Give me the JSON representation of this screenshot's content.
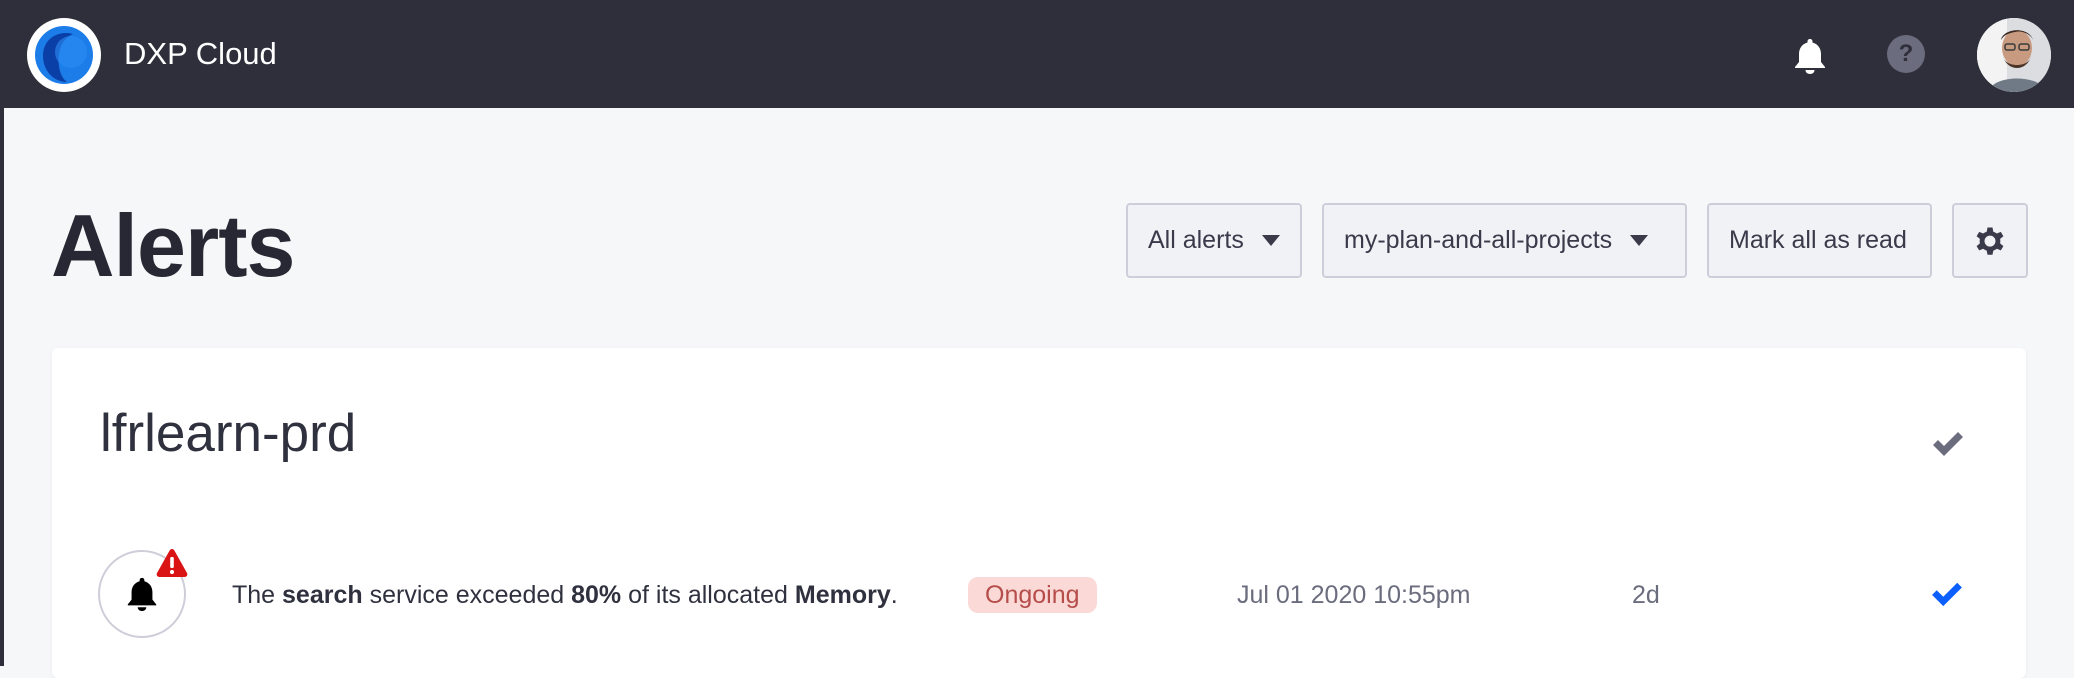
{
  "app": {
    "title": "DXP Cloud",
    "logo_icon": "dxp-cloud-logo",
    "accent": "#0b5fff",
    "navbar_bg": "#2e2f3a"
  },
  "navbar": {
    "bell_icon": "bell-icon",
    "help_label": "?",
    "avatar_icon": "user-avatar"
  },
  "page": {
    "title": "Alerts"
  },
  "toolbar": {
    "filter_label": "All alerts",
    "project_label": "my-plan-and-all-projects",
    "mark_read_label": "Mark all as read",
    "settings_icon": "gear-icon"
  },
  "group": {
    "project_name": "lfrlearn-prd",
    "alert": {
      "text_prefix": "The ",
      "service": "search",
      "text_mid1": " service exceeded ",
      "percent": "80%",
      "text_mid2": " of its allocated ",
      "resource": "Memory",
      "text_suffix": ".",
      "status": "Ongoing",
      "status_color": "#fbd9d7",
      "date": "Jul 01 2020 10:55pm",
      "age": "2d",
      "warning_color": "#da1414"
    }
  }
}
